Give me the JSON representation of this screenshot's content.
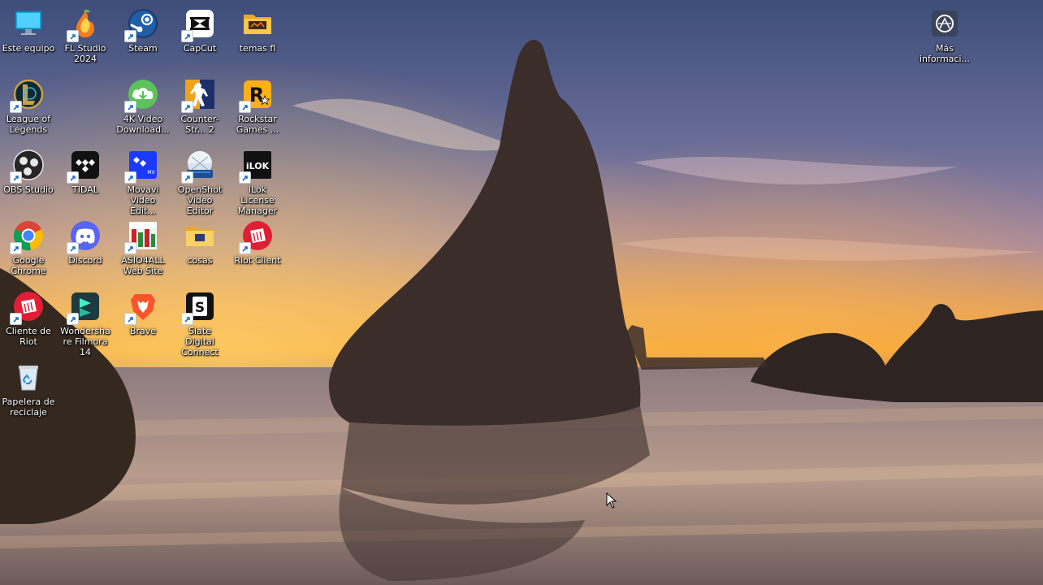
{
  "desktop": {
    "icons": [
      {
        "label": "Este equipo"
      },
      {
        "label": "FL Studio 2024"
      },
      {
        "label": "Steam"
      },
      {
        "label": "CapCut"
      },
      {
        "label": "temas fl"
      },
      {
        "label": "League of Legends"
      },
      {
        "label": "4K Video Download..."
      },
      {
        "label": "Counter-Str... 2"
      },
      {
        "label": "Rockstar Games ..."
      },
      {
        "label": "OBS Studio"
      },
      {
        "label": "TIDAL"
      },
      {
        "label": "Movavi Video Edit..."
      },
      {
        "label": "OpenShot Video Editor"
      },
      {
        "label": "iLok License Manager"
      },
      {
        "label": "Google Chrome"
      },
      {
        "label": "Discord"
      },
      {
        "label": "ASIO4ALL Web Site"
      },
      {
        "label": "cosas"
      },
      {
        "label": "Riot Client"
      },
      {
        "label": "Cliente de Riot"
      },
      {
        "label": "Wondershare Filmora 14"
      },
      {
        "label": "Brave"
      },
      {
        "label": "Slate Digital Connect"
      },
      {
        "label": "Papelera de reciclaje"
      }
    ],
    "more_info": {
      "label": "Más informaci..."
    }
  }
}
